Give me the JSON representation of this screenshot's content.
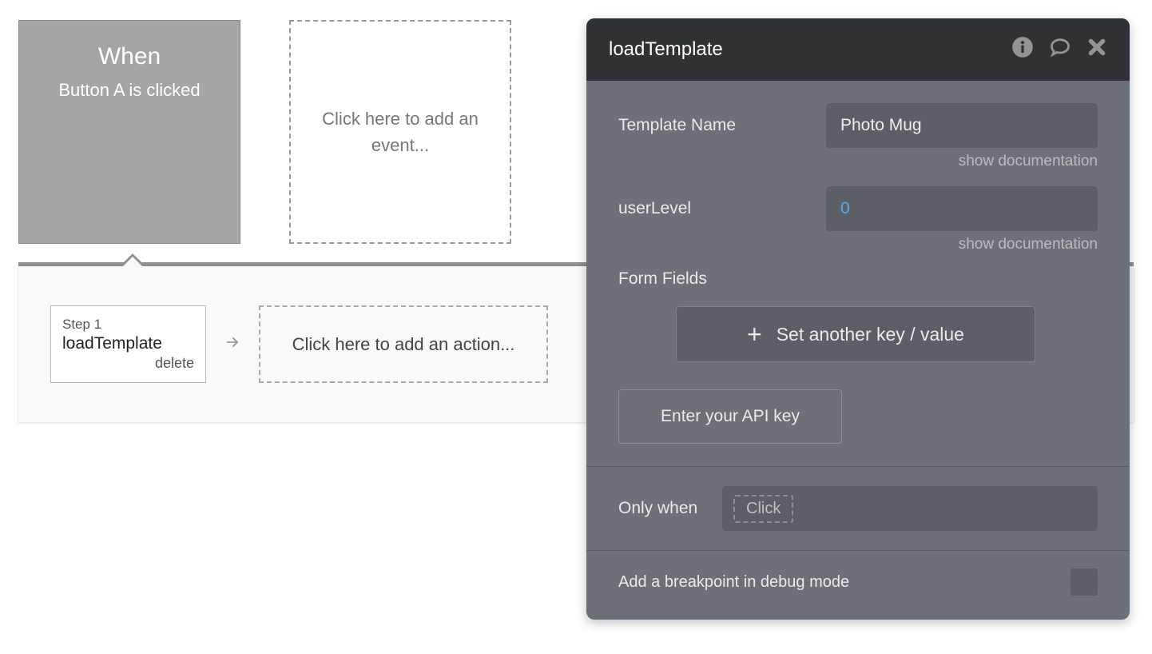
{
  "event": {
    "title": "When",
    "description": "Button A is clicked"
  },
  "add_event_placeholder": "Click here to add an event...",
  "step": {
    "label": "Step 1",
    "action": "loadTemplate",
    "delete_label": "delete"
  },
  "add_action_placeholder": "Click here to add an action...",
  "panel": {
    "title": "loadTemplate",
    "props": {
      "template_name": {
        "label": "Template Name",
        "value": "Photo Mug",
        "doc": "show documentation"
      },
      "user_level": {
        "label": "userLevel",
        "value": "0",
        "doc": "show documentation"
      }
    },
    "form_fields_label": "Form Fields",
    "kv_button": "Set another key / value",
    "api_button": "Enter your API key",
    "only_when": {
      "label": "Only when",
      "chip": "Click"
    },
    "breakpoint_label": "Add a breakpoint in debug mode"
  }
}
